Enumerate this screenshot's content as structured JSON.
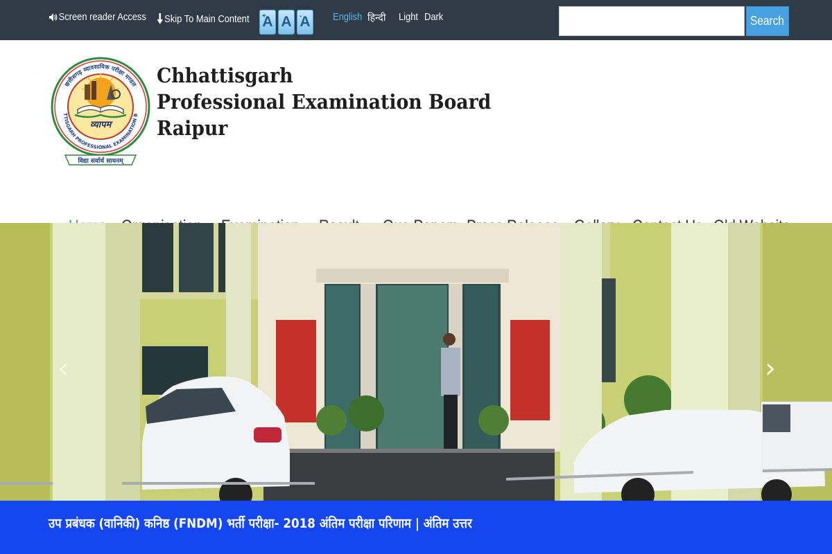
{
  "topbar": {
    "screen_reader_label": "Screen reader Access",
    "skip_label": "Skip To Main Content",
    "font_size_buttons": [
      "A",
      "A",
      "A"
    ],
    "font_size_marks": [
      "+",
      "",
      "-"
    ],
    "lang_english": "English",
    "lang_hindi": "हिन्दी",
    "theme_light": "Light",
    "theme_dark": "Dark",
    "search_value": "",
    "search_button": "Search",
    "colors": {
      "bar": "#2f3b47",
      "accent": "#47a1e0",
      "active_lang": "#5fb3e8"
    }
  },
  "header": {
    "title_line1": "Chhattisgarh",
    "title_line2": "Professional Examination Board",
    "title_line3": "Raipur",
    "logo": {
      "top_arc_text": "छत्तीसगढ़ व्यावसायिक परीक्षा मण्डल",
      "bottom_arc_text": "CHHATTISGARH PROFESSIONAL EXAMINATION BOARD",
      "center_text": "व्यापम",
      "motto": "विद्या सर्वार्थ साधनम्",
      "icon": "open-book-emblem-icon"
    }
  },
  "nav": {
    "items": [
      {
        "label": "Home",
        "active": true,
        "dropdown": false
      },
      {
        "label": "Organisation",
        "active": false,
        "dropdown": true
      },
      {
        "label": "Examination",
        "active": false,
        "dropdown": true
      },
      {
        "label": "Result",
        "active": false,
        "dropdown": true
      },
      {
        "label": "Que.Papers",
        "active": false,
        "dropdown": false
      },
      {
        "label": "Press Release",
        "active": false,
        "dropdown": true
      },
      {
        "label": "Gallary",
        "active": false,
        "dropdown": false
      },
      {
        "label": "Contact Us",
        "active": false,
        "dropdown": false
      },
      {
        "label": "Old Website",
        "active": false,
        "dropdown": false
      }
    ],
    "active_color": "#4a90c8"
  },
  "hero": {
    "prev_icon": "chevron-left-icon",
    "next_icon": "chevron-right-icon",
    "prev_glyph": "‹",
    "next_glyph": "›"
  },
  "notice": {
    "text": "उप प्रबंधक (वानिकी) कनिष्ठ (FNDM) भर्ती परीक्षा- 2018 अंतिम परीक्षा परिणाम  | अंतिम उत्तर",
    "bg_color": "#1447f0"
  }
}
